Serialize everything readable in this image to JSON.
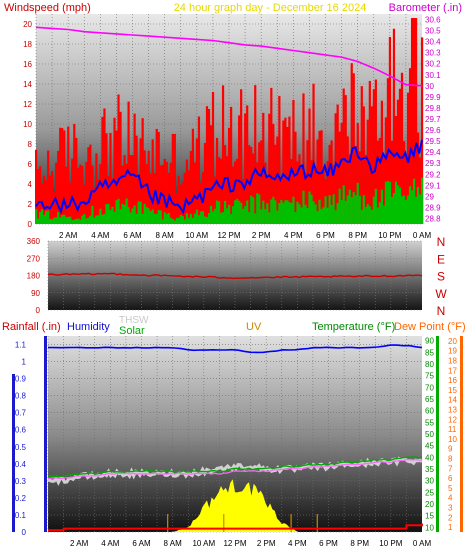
{
  "header": {
    "title_left": "Windspeed (mph)",
    "title_center": "24 hour graph day - December 16 2024",
    "title_right": "Barometer (.in)"
  },
  "colors": {
    "wind_avg": "#0000ff",
    "wind_gust": "#ff0000",
    "wind_base": "#00c000",
    "barometer": "#ff00ff",
    "direction": "#cc0000",
    "temperature": "#00aa00",
    "dewpoint": "#ff6600",
    "humidity": "#0000ff",
    "rain": "#ff0000",
    "solar": "#ffff00",
    "uv": "#cc8800",
    "thsw": "#d0d0d0"
  },
  "wind_panel": {
    "left_ticks": [
      "0",
      "2",
      "4",
      "6",
      "8",
      "10",
      "12",
      "14",
      "16",
      "18",
      "20"
    ],
    "right_ticks": [
      "28.8",
      "28.9",
      "29",
      "29.1",
      "29.2",
      "29.3",
      "29.4",
      "29.5",
      "29.6",
      "29.7",
      "29.8",
      "29.9",
      "30",
      "30.1",
      "30.2",
      "30.3",
      "30.4",
      "30.5",
      "30.6"
    ]
  },
  "dir_panel": {
    "left_ticks": [
      "0",
      "90",
      "180",
      "270",
      "360"
    ],
    "right_labels": [
      "N",
      "E",
      "S",
      "W",
      "N"
    ]
  },
  "bottom_panel": {
    "legend": {
      "rain": "Rainfall (.in)",
      "humidity": "Humidity",
      "thsw": "THSW",
      "solar": "Solar",
      "uv": "UV",
      "temperature": "Temperature (°F)",
      "dewpoint": "Dew Point (°F)"
    },
    "rain_ticks": [
      "0",
      "0.1",
      "0.2",
      "0.3",
      "0.4",
      "0.5",
      "0.6",
      "0.7",
      "0.8",
      "0.9",
      "1",
      "1.1"
    ],
    "temp_ticks": [
      "10",
      "15",
      "20",
      "25",
      "30",
      "35",
      "40",
      "45",
      "50",
      "55",
      "60",
      "65",
      "70",
      "75",
      "80",
      "85",
      "90"
    ],
    "uv_ticks": [
      "1",
      "2",
      "3",
      "4",
      "5",
      "6",
      "7",
      "8",
      "9",
      "10",
      "11",
      "12",
      "13",
      "14",
      "15",
      "16",
      "17",
      "18",
      "19",
      "20"
    ]
  },
  "x_labels": [
    "2 AM",
    "4 AM",
    "6 AM",
    "8 AM",
    "10 AM",
    "12 PM",
    "2 PM",
    "4 PM",
    "6 PM",
    "8 PM",
    "10 PM",
    "0 AM"
  ],
  "chart_data": [
    {
      "type": "line",
      "x": [
        "0 AM",
        "1 AM",
        "2 AM",
        "3 AM",
        "4 AM",
        "5 AM",
        "6 AM",
        "7 AM",
        "8 AM",
        "9 AM",
        "10 AM",
        "11 AM",
        "12 PM",
        "1 PM",
        "2 PM",
        "3 PM",
        "4 PM",
        "5 PM",
        "6 PM",
        "7 PM",
        "8 PM",
        "9 PM",
        "10 PM",
        "11 PM",
        "0 AM"
      ],
      "series": [
        {
          "name": "Windspeed",
          "axis": "left",
          "values": [
            2.5,
            2.0,
            1.8,
            2.2,
            3.5,
            4.0,
            4.8,
            3.0,
            2.2,
            1.5,
            2.5,
            3.5,
            4.0,
            4.2,
            5.0,
            4.5,
            5.0,
            5.5,
            5.0,
            6.0,
            7.5,
            5.5,
            7.0,
            6.5,
            8.0
          ]
        },
        {
          "name": "Gust",
          "axis": "left",
          "values": [
            7,
            8,
            10,
            9,
            11,
            12,
            11,
            10,
            10,
            8,
            10,
            12,
            13,
            12,
            13,
            12,
            12,
            13,
            12,
            14,
            15,
            14,
            17,
            20,
            18
          ]
        },
        {
          "name": "Barometer",
          "axis": "right",
          "values": [
            30.53,
            30.52,
            30.51,
            30.49,
            30.48,
            30.47,
            30.46,
            30.45,
            30.44,
            30.43,
            30.42,
            30.41,
            30.39,
            30.37,
            30.36,
            30.34,
            30.32,
            30.3,
            30.28,
            30.26,
            30.22,
            30.16,
            30.09,
            30.01,
            30.0
          ]
        }
      ],
      "ylim_left": [
        0,
        21
      ],
      "ylim_right": [
        28.75,
        30.65
      ]
    },
    {
      "type": "line",
      "x": [
        "0 AM",
        "2 AM",
        "4 AM",
        "6 AM",
        "8 AM",
        "10 AM",
        "12 PM",
        "2 PM",
        "4 PM",
        "6 PM",
        "8 PM",
        "10 PM",
        "0 AM"
      ],
      "series": [
        {
          "name": "Wind Direction",
          "values": [
            185,
            186,
            190,
            182,
            178,
            172,
            168,
            170,
            172,
            174,
            176,
            178,
            182
          ]
        }
      ],
      "ylim": [
        0,
        360
      ]
    },
    {
      "type": "line",
      "x": [
        "0 AM",
        "1 AM",
        "2 AM",
        "3 AM",
        "4 AM",
        "5 AM",
        "6 AM",
        "7 AM",
        "8 AM",
        "9 AM",
        "10 AM",
        "11 AM",
        "12 PM",
        "1 PM",
        "2 PM",
        "3 PM",
        "4 PM",
        "5 PM",
        "6 PM",
        "7 PM",
        "8 PM",
        "9 PM",
        "10 PM",
        "11 PM",
        "0 AM"
      ],
      "series": [
        {
          "name": "Humidity",
          "axis": "temperature",
          "values": [
            87,
            87,
            87,
            87,
            87,
            87,
            87,
            87,
            87,
            86,
            86,
            86,
            86,
            85,
            85,
            86,
            86,
            87,
            87,
            87,
            87,
            87,
            88,
            88,
            87
          ]
        },
        {
          "name": "Temperature",
          "axis": "temperature",
          "values": [
            32,
            32,
            33,
            33,
            34,
            34,
            34,
            34,
            34,
            34,
            34,
            34,
            35,
            35,
            35,
            36,
            36,
            37,
            37,
            38,
            38,
            39,
            39,
            40,
            40
          ]
        },
        {
          "name": "Dew Point",
          "axis": "temperature",
          "values": [
            31,
            31,
            32,
            32,
            33,
            33,
            33,
            33,
            33,
            33,
            33,
            33,
            34,
            34,
            34,
            35,
            35,
            36,
            36,
            37,
            37,
            38,
            38,
            39,
            39
          ]
        },
        {
          "name": "THSW",
          "axis": "temperature",
          "values": [
            31,
            30,
            32,
            32,
            33,
            33,
            33,
            33,
            33,
            33,
            34,
            35,
            36,
            36,
            35,
            35,
            35,
            36,
            36,
            37,
            37,
            38,
            38,
            39,
            38
          ]
        },
        {
          "name": "Rainfall",
          "axis": "rain",
          "values": [
            0.01,
            0.02,
            0.02,
            0.02,
            0.02,
            0.02,
            0.02,
            0.02,
            0.02,
            0.02,
            0.02,
            0.02,
            0.02,
            0.02,
            0.02,
            0.02,
            0.02,
            0.02,
            0.02,
            0.02,
            0.02,
            0.02,
            0.02,
            0.04,
            0.05
          ]
        },
        {
          "name": "Solar",
          "axis": "uv",
          "values": [
            0,
            0,
            0,
            0,
            0,
            0,
            0,
            0,
            0,
            0.5,
            2.5,
            4.0,
            5.0,
            4.5,
            3.0,
            1.0,
            0,
            0,
            0,
            0,
            0,
            0,
            0,
            0,
            0
          ]
        }
      ],
      "ylim_rain": [
        0,
        1.15
      ],
      "ylim_temperature": [
        8,
        92
      ],
      "ylim_uv": [
        0.5,
        20.5
      ]
    }
  ]
}
